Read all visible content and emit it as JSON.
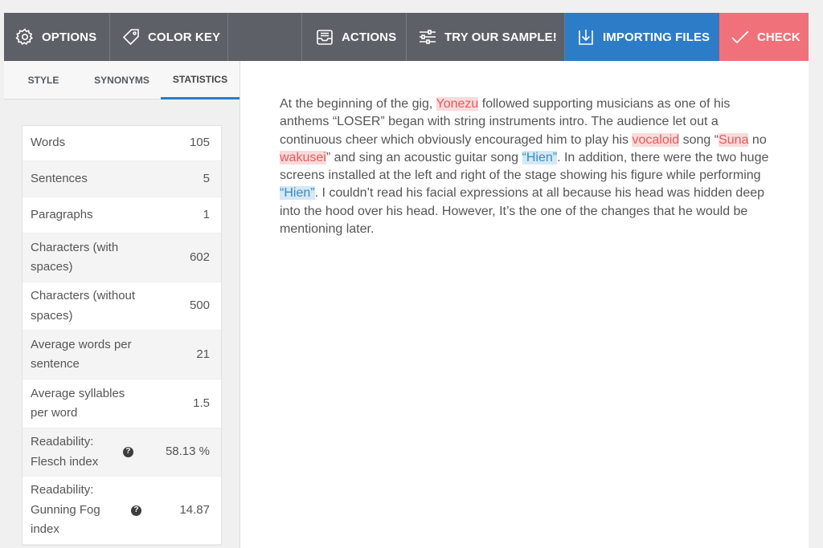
{
  "toolbar": {
    "options_label": "OPTIONS",
    "color_key_label": "COLOR KEY",
    "actions_label": "ACTIONS",
    "try_sample_label": "TRY OUR SAMPLE!",
    "importing_files_label": "IMPORTING FILES",
    "check_label": "CHECK"
  },
  "colors": {
    "toolbar_bg": "#5d6067",
    "importing_bg": "#2d7cc7",
    "check_bg": "#f0717a",
    "highlight_red": "#fbdada",
    "highlight_blue": "#d5e8f5"
  },
  "tabs": [
    "STYLE",
    "SYNONYMS",
    "STATISTICS"
  ],
  "active_tab": "STATISTICS",
  "stats": [
    {
      "label": "Words",
      "value": "105"
    },
    {
      "label": "Sentences",
      "value": "5"
    },
    {
      "label": "Paragraphs",
      "value": "1"
    },
    {
      "label": "Characters (with spaces)",
      "value": "602"
    },
    {
      "label": "Characters (without spaces)",
      "value": "500"
    },
    {
      "label": "Average words per sentence",
      "value": "21"
    },
    {
      "label": "Average syllables per word",
      "value": "1.5"
    },
    {
      "label": "Readability: Flesch index",
      "value": "58.13 %"
    },
    {
      "label": "Readability: Gunning Fog index",
      "value": "14.87"
    }
  ],
  "text": {
    "p1": "At the beginning of the gig, ",
    "w_yonezu": "Yonezu",
    "p2": " followed supporting musicians as one of his anthems “LOSER” began with string instruments intro. The audience let out a continuous cheer which obviously encouraged him to play his ",
    "w_vocaloid": "vocaloid",
    "p3": " song “",
    "w_suna": "Suna",
    "p4": " no ",
    "w_wakusei": "wakusei",
    "p5": "” and sing an acoustic guitar song ",
    "w_hien1": "“Hien”",
    "p6": ". In addition, there were the two huge screens installed at the left and right of the stage showing his figure while performing ",
    "w_hien2": "“Hien”",
    "p7": ". I couldn’t read his facial expressions at all because his head was hidden deep into the hood over his head. However, It’s the one of the changes that he would be mentioning later."
  }
}
